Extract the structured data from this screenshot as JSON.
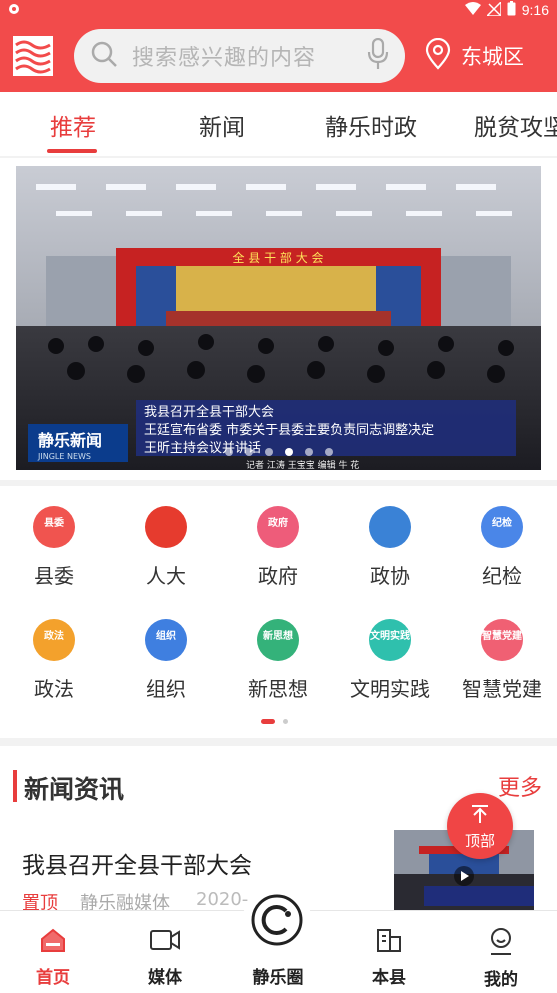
{
  "status_bar": {
    "time": "9:16"
  },
  "header": {
    "search_placeholder": "搜索感兴趣的内容",
    "location": "东城区"
  },
  "tabs": [
    {
      "label": "推荐",
      "active": true
    },
    {
      "label": "新闻",
      "active": false
    },
    {
      "label": "静乐时政",
      "active": false
    },
    {
      "label": "脱贫攻坚",
      "active": false
    }
  ],
  "banner": {
    "hall_banner": "全 县 干 部 大 会",
    "caption_lines": [
      "我县召开全县干部大会",
      "王廷宣布省委 市委关于县委主要负责同志调整决定",
      "王昕主持会议并讲话"
    ],
    "logo_text": "静乐新闻",
    "logo_sub": "JINGLE NEWS",
    "credits": "记者  江涛  王宝宝  编辑  牛  花",
    "slide_count": 6,
    "active_slide": 3
  },
  "grid": [
    {
      "label": "县委",
      "badge": "县委",
      "color": "#f0544f",
      "icon": "party-emblem-icon"
    },
    {
      "label": "人大",
      "badge": "",
      "color": "#e63b2e",
      "icon": "national-emblem-icon"
    },
    {
      "label": "政府",
      "badge": "政府",
      "color": "#ee5c7a",
      "icon": "government-icon"
    },
    {
      "label": "政协",
      "badge": "",
      "color": "#3a82d6",
      "icon": "cppcc-emblem-icon"
    },
    {
      "label": "纪检",
      "badge": "纪检",
      "color": "#4a86e8",
      "icon": "discipline-icon"
    },
    {
      "label": "政法",
      "badge": "政法",
      "color": "#f3a12c",
      "icon": "law-icon"
    },
    {
      "label": "组织",
      "badge": "组织",
      "color": "#3f7fe0",
      "icon": "organization-icon"
    },
    {
      "label": "新思想",
      "badge": "新思想",
      "color": "#34b27a",
      "icon": "new-thought-icon"
    },
    {
      "label": "文明实践",
      "badge": "文明实践",
      "color": "#2fc0ad",
      "icon": "civilization-icon"
    },
    {
      "label": "智慧党建",
      "badge": "智慧党建",
      "color": "#f06073",
      "icon": "party-building-icon"
    }
  ],
  "news": {
    "section_title": "新闻资讯",
    "more_label": "更多",
    "item": {
      "title": "我县召开全县干部大会",
      "pinned": "置顶",
      "source": "静乐融媒体",
      "date": "2020-"
    }
  },
  "to_top_label": "顶部",
  "bottom_nav": [
    {
      "label": "首页",
      "icon": "home-icon",
      "active": true
    },
    {
      "label": "媒体",
      "icon": "video-icon",
      "active": false
    },
    {
      "label": "静乐圈",
      "icon": "circle-icon",
      "active": false
    },
    {
      "label": "本县",
      "icon": "building-icon",
      "active": false
    },
    {
      "label": "我的",
      "icon": "user-icon",
      "active": false
    }
  ],
  "colors": {
    "brand_red": "#f24b4b",
    "accent": "#e83d3d"
  }
}
